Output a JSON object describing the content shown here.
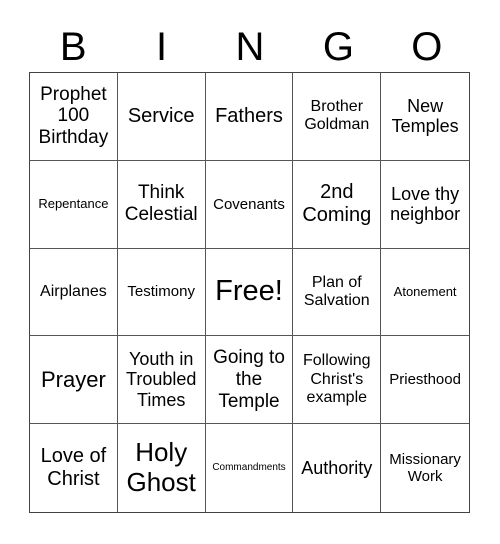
{
  "header": [
    "B",
    "I",
    "N",
    "G",
    "O"
  ],
  "cells": [
    "Prophet 100 Birthday",
    "Service",
    "Fathers",
    "Brother Goldman",
    "New Temples",
    "Repentance",
    "Think Celestial",
    "Covenants",
    "2nd Coming",
    "Love thy neighbor",
    "Airplanes",
    "Testimony",
    "Free!",
    "Plan of Salvation",
    "Atonement",
    "Prayer",
    "Youth in Troubled Times",
    "Going to the Temple",
    "Following Christ's example",
    "Priesthood",
    "Love of Christ",
    "Holy Ghost",
    "Commandments",
    "Authority",
    "Missionary Work"
  ]
}
